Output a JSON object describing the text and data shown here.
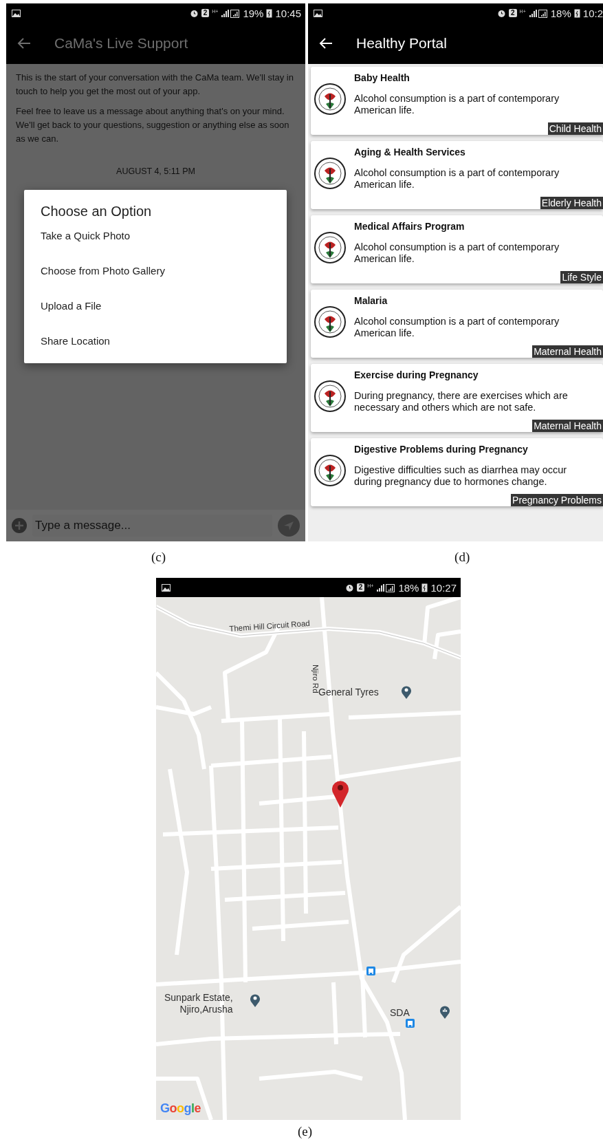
{
  "chat_screen": {
    "status_bar": {
      "sim": "2",
      "network": "H+",
      "battery": "19%",
      "time": "10:45"
    },
    "title": "CaMa's Live Support",
    "intro_paragraphs": [
      "This is the start of your conversation with the CaMa team. We'll stay in touch to help you get the most out of your app.",
      "Feel free to leave us a message about anything that's on your mind. We'll get back to your questions, suggestion or anything else as soon as we can."
    ],
    "date_divider": "AUGUST 4, 5:11 PM",
    "dialog": {
      "title": "Choose an Option",
      "options": [
        "Take a Quick Photo",
        "Choose from Photo Gallery",
        "Upload a File",
        "Share Location"
      ]
    },
    "composer": {
      "placeholder": "Type a message..."
    },
    "caption": "(c)"
  },
  "portal_screen": {
    "status_bar": {
      "sim": "2",
      "network": "H+",
      "battery": "18%",
      "time": "10:2"
    },
    "title": "Healthy Portal",
    "articles": [
      {
        "title": "Baby Health",
        "summary": "Alcohol consumption is a part of contemporary American life.",
        "category": "Child Health"
      },
      {
        "title": "Aging & Health Services",
        "summary": "Alcohol consumption is a part of contemporary American life.",
        "category": "Elderly Health"
      },
      {
        "title": "Medical Affairs Program",
        "summary": "Alcohol consumption is a part of contemporary American life.",
        "category": "Life Style"
      },
      {
        "title": "Malaria",
        "summary": "Alcohol consumption is a part of contemporary American life.",
        "category": "Maternal Health"
      },
      {
        "title": "Exercise during Pregnancy",
        "summary": "During pregnancy, there are exercises which are necessary and others which are not safe.",
        "category": "Maternal Health"
      },
      {
        "title": "Digestive Problems during Pregnancy",
        "summary": "Digestive difficulties such as diarrhea may occur during pregnancy due to hormones change.",
        "category": "Pregnancy Problems"
      }
    ],
    "caption": "(d)"
  },
  "map_screen": {
    "status_bar": {
      "sim": "2",
      "network": "H+",
      "battery": "18%",
      "time": "10:27"
    },
    "road_labels": [
      {
        "text": "Themi Hill Circuit Road"
      },
      {
        "text": "Njiro Rd"
      }
    ],
    "places": [
      {
        "name": "General Tyres"
      },
      {
        "name": "Sunpark Estate,\nNjiro,Arusha"
      },
      {
        "name": "SDA"
      }
    ],
    "logo": "Google",
    "caption": "(e)"
  }
}
